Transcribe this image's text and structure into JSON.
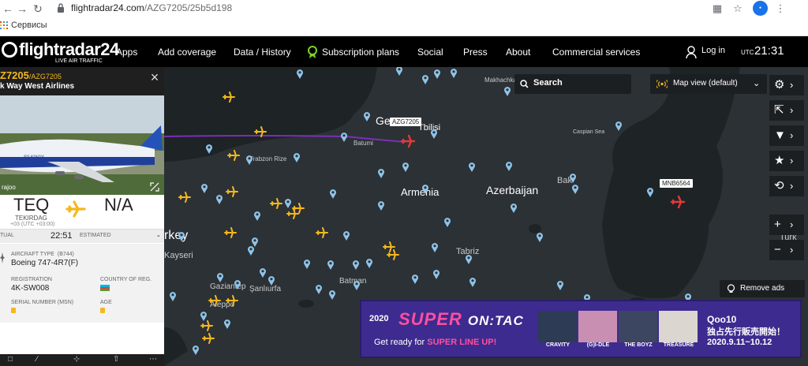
{
  "browser": {
    "url_host": "flightradar24.com",
    "url_path": "/AZG7205/25b5d198",
    "bookmarks_label": "Сервисы",
    "back_icon": "arrow-left-icon",
    "forward_icon": "arrow-right-icon",
    "reload_icon": "reload-icon"
  },
  "nav": {
    "logo_text": "flightradar24",
    "logo_tagline": "LIVE AIR TRAFFIC",
    "items": [
      "Apps",
      "Add coverage",
      "Data / History",
      "Subscription plans",
      "Social",
      "Press",
      "About",
      "Commercial services"
    ],
    "login": "Log in",
    "utc_label": "UTC",
    "utc_time": "21:31"
  },
  "panel": {
    "flight": "Z7205",
    "flight_sub": "/AZG7205",
    "airline": "k Way West Airlines",
    "photo_credit": "rajoo",
    "origin": {
      "code": "TEQ",
      "city": "TEKIRDAG",
      "tz": "+03 (UTC +03:00)"
    },
    "destination": {
      "code": "N/A"
    },
    "times": {
      "actual_label": "TUAL",
      "actual_value": "22:51",
      "estimated_label": "ESTIMATED",
      "estimated_value": "-"
    },
    "aircraft_type_label": "AIRCRAFT TYPE",
    "aircraft_type_code": "(B744)",
    "aircraft_type": "Boeing 747-4R7(F)",
    "registration_label": "REGISTRATION",
    "registration": "4K-SW008",
    "country_label": "COUNTRY OF REG.",
    "serial_label": "SERIAL NUMBER (MSN)",
    "age_label": "AGE"
  },
  "map": {
    "search_label": "Search",
    "mapview_label": "Map view (default)",
    "remove_ads": "Remove ads",
    "callsigns": [
      "AZG7205",
      "MNB6564"
    ],
    "labels": {
      "tbilisi": "Tbilisi",
      "azerbaijan": "Azerbaijan",
      "armenia": "Armenia",
      "georgia_partial": "Ge",
      "baku_partial": "Bak",
      "turkey_partial": "rkey",
      "kayseri": "Kayseri",
      "tabriz": "Tabriz",
      "batman": "Batman",
      "sanliurfa": "Şanlıurfa",
      "aleppo": "Aleppo",
      "gaziantep": "Gaziantep",
      "batumi": "Batumi",
      "trabzon": "Trabzon Rize",
      "makhachkala": "Makhachkala",
      "caspian": "Caspian Sea",
      "turkmen_partial": "Turk"
    }
  },
  "ad": {
    "year": "2020",
    "title_main": "SUPER",
    "title_tail": "ON:TAC",
    "subtitle_prefix": "Get ready for",
    "subtitle_highlight": "SUPER LINE UP!",
    "groups": [
      "CRAVITY",
      "(G)I-DLE",
      "THE BOYZ",
      "TREASURE"
    ],
    "brand": "Qoo10",
    "brand_sub": "独占先行販売開始！",
    "dates": "2020.9.11~10.12"
  }
}
